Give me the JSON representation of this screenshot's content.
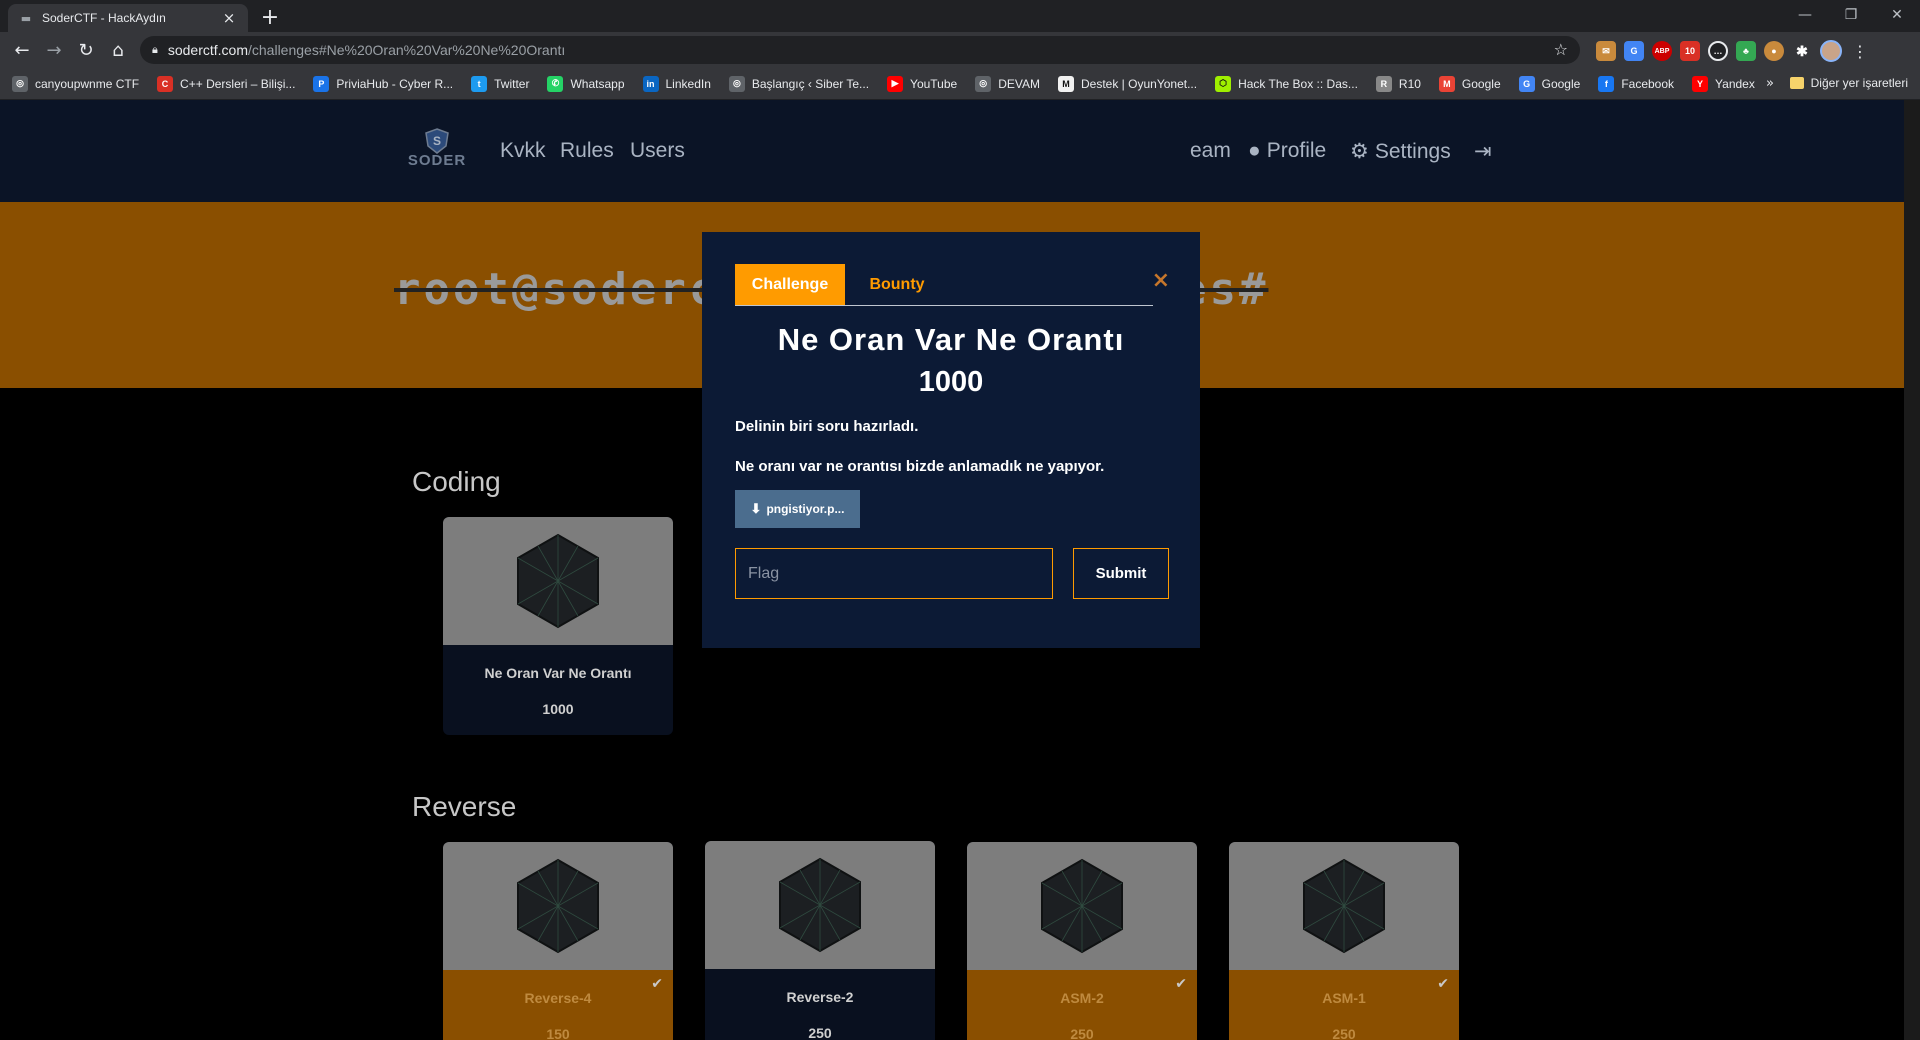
{
  "browser": {
    "tab_title": "SoderCTF - HackAydın",
    "url_host": "soderctf.com",
    "url_path": "/challenges#Ne%20Oran%20Var%20Ne%20Orantı",
    "window_controls": [
      "—",
      "❐",
      "✕"
    ]
  },
  "bookmarks": [
    {
      "label": "canyoupwnme CTF",
      "icon": "globe-icon",
      "color": "#5f6368"
    },
    {
      "label": "C++ Dersleri – Bilişi...",
      "icon": "cpp-icon",
      "color": "#d93025"
    },
    {
      "label": "PriviaHub - Cyber R...",
      "icon": "privia-icon",
      "color": "#1a73e8"
    },
    {
      "label": "Twitter",
      "icon": "twitter-icon",
      "color": "#1d9bf0"
    },
    {
      "label": "Whatsapp",
      "icon": "whatsapp-icon",
      "color": "#25d366"
    },
    {
      "label": "LinkedIn",
      "icon": "linkedin-icon",
      "color": "#0a66c2"
    },
    {
      "label": "Başlangıç ‹ Siber Te...",
      "icon": "globe-icon",
      "color": "#5f6368"
    },
    {
      "label": "YouTube",
      "icon": "youtube-icon",
      "color": "#ff0000"
    },
    {
      "label": "DEVAM",
      "icon": "globe-icon",
      "color": "#5f6368"
    },
    {
      "label": "Destek | OyunYonet...",
      "icon": "oyun-icon",
      "color": "#f1f1f1"
    },
    {
      "label": "Hack The Box :: Das...",
      "icon": "htb-icon",
      "color": "#9fef00"
    },
    {
      "label": "R10",
      "icon": "r10-icon",
      "color": "#888888"
    },
    {
      "label": "Google",
      "icon": "gmail-icon",
      "color": "#ea4335"
    },
    {
      "label": "Google",
      "icon": "google-icon",
      "color": "#4285f4"
    },
    {
      "label": "Facebook",
      "icon": "facebook-icon",
      "color": "#1877f2"
    },
    {
      "label": "Yandex",
      "icon": "yandex-icon",
      "color": "#ff0000"
    }
  ],
  "bookmarks_more": "»",
  "bookmarks_other": "Diğer yer işaretleri",
  "site_nav": {
    "logo_text": "SODER",
    "links": [
      {
        "label": "Kvkk"
      },
      {
        "label": "Rules"
      },
      {
        "label": "Users"
      },
      {
        "label": "eam"
      },
      {
        "label": "Profile"
      },
      {
        "label": "Settings"
      }
    ]
  },
  "banner": {
    "left": "root@soderc",
    "right": "es#"
  },
  "categories": [
    {
      "title": "Coding",
      "cards": [
        {
          "title": "Ne Oran Var Ne Orantı",
          "points": "1000",
          "solved": false
        }
      ]
    },
    {
      "title": "Reverse",
      "cards": [
        {
          "title": "Reverse-4",
          "points": "150",
          "solved": true
        },
        {
          "title": "Reverse-2",
          "points": "250",
          "solved": false
        },
        {
          "title": "ASM-2",
          "points": "250",
          "solved": true
        },
        {
          "title": "ASM-1",
          "points": "250",
          "solved": true
        }
      ]
    }
  ],
  "modal": {
    "tab_challenge": "Challenge",
    "tab_bounty": "Bounty",
    "close": "×",
    "title": "Ne Oran Var Ne Orantı",
    "value": "1000",
    "desc1": "Delinin biri soru hazırladı.",
    "desc2": "Ne oranı var ne orantısı bizde anlamadık ne yapıyor.",
    "file_label": "pngistiyor.p...",
    "flag_placeholder": "Flag",
    "submit_label": "Submit"
  },
  "colors": {
    "accent": "#ff9b00",
    "nav_bg": "#0b1426",
    "banner_bg": "#8a4f00",
    "modal_bg": "#0c1a35"
  }
}
